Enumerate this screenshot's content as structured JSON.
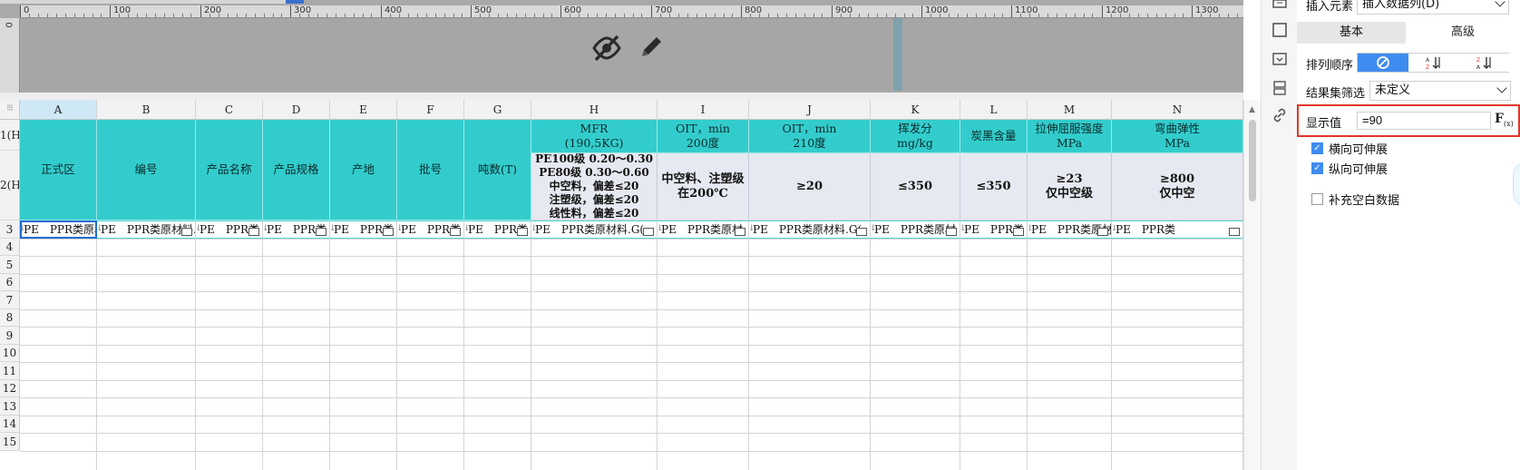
{
  "ruler": {
    "h_ticks": [
      "0",
      "100",
      "200",
      "300",
      "400",
      "500",
      "600",
      "700",
      "800",
      "900",
      "1000",
      "1100",
      "1200",
      "1300"
    ],
    "v_tick": "0"
  },
  "grid": {
    "corner": "⁝⁝⁝",
    "columns": [
      "A",
      "B",
      "C",
      "D",
      "E",
      "F",
      "G",
      "H",
      "I",
      "J",
      "K",
      "L",
      "M",
      "N"
    ],
    "active_column": "A",
    "row_headers": [
      "1(H)",
      "2(H)",
      "3",
      "4",
      "5",
      "6",
      "7",
      "8",
      "9",
      "10",
      "11",
      "12",
      "13",
      "14",
      "15"
    ],
    "header_cells": {
      "A": "正式区",
      "B": "编号",
      "C": "产品名称",
      "D": "产品规格",
      "E": "产地",
      "F": "批号",
      "G": "吨数(T)"
    },
    "h_header": [
      "MFR",
      "(190,5KG)"
    ],
    "h_spec": [
      "PE100级 0.20～0.30",
      "PE80级 0.30～0.60",
      "中空料，偏差≤20",
      "注塑级，偏差≤20",
      "线性料，偏差≤20"
    ],
    "i_header": [
      "OIT，min",
      "200度"
    ],
    "i_spec": [
      "中空料、注塑级",
      "在200℃"
    ],
    "j_header": [
      "OIT，min",
      "210度"
    ],
    "j_spec": "≥20",
    "k_header": [
      "挥发分",
      "mg/kg"
    ],
    "k_spec": "≤350",
    "l_header": "炭黑含量",
    "l_spec": "≤350",
    "m_header": [
      "拉伸屈服强度",
      "MPa"
    ],
    "m_spec": [
      "≥23",
      "仅中空级"
    ],
    "n_header": [
      "弯曲弹性",
      "MPa"
    ],
    "n_spec": [
      "≥800",
      "仅中空"
    ],
    "row3": [
      "PE　PPR类原材",
      "PE　PPR类原材料.",
      "PE　PPR类",
      "PE　PPR类",
      "PE　PPR类",
      "PE　PPR类",
      "PE　PPR类",
      "PE　PPR类原材料.G(",
      "PE　PPR类原材",
      "PE　PPR类原材料.G(",
      "PE　PPR类原材",
      "PE　PPR类",
      "PE　PPR类原材",
      "PE　PPR类"
    ]
  },
  "panel": {
    "insert_label": "插入元素",
    "insert_value": "插入数据列(D)",
    "tabs": [
      "基本",
      "高级"
    ],
    "active_tab": "基本",
    "sort_label": "排列顺序",
    "sort_options": [
      "none",
      "ascending",
      "descending"
    ],
    "sort_selected": "none",
    "filter_label": "结果集筛选",
    "filter_value": "未定义",
    "display_label": "显示值",
    "display_value": "=90",
    "fx_label": "F",
    "fx_sub": "(x)",
    "checkboxes": [
      {
        "label": "横向可伸展",
        "checked": true
      },
      {
        "label": "纵向可伸展",
        "checked": true
      },
      {
        "label": "补充空白数据",
        "checked": false
      }
    ]
  },
  "colors": {
    "header_teal": "#33cccc",
    "spec_bg": "#e6e9f1",
    "accent_blue": "#3f8cf0",
    "highlight_red": "#e0362c",
    "design_gray": "#a6a6a6"
  }
}
